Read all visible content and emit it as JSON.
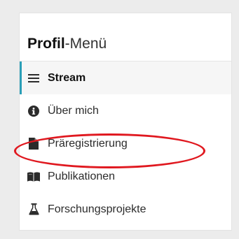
{
  "panel": {
    "title_strong": "Profil",
    "title_rest": "-Menü"
  },
  "menu": {
    "items": [
      {
        "label": "Stream",
        "icon": "bars-icon",
        "active": true
      },
      {
        "label": "Über mich",
        "icon": "info-circle-icon",
        "active": false
      },
      {
        "label": "Präregistrierung",
        "icon": "file-icon",
        "active": false
      },
      {
        "label": "Publikationen",
        "icon": "book-open-icon",
        "active": false
      },
      {
        "label": "Forschungsprojekte",
        "icon": "flask-icon",
        "active": false
      }
    ]
  },
  "colors": {
    "accent": "#2a9fb7",
    "highlight": "#e0181f",
    "icon": "#2b2b2b"
  }
}
